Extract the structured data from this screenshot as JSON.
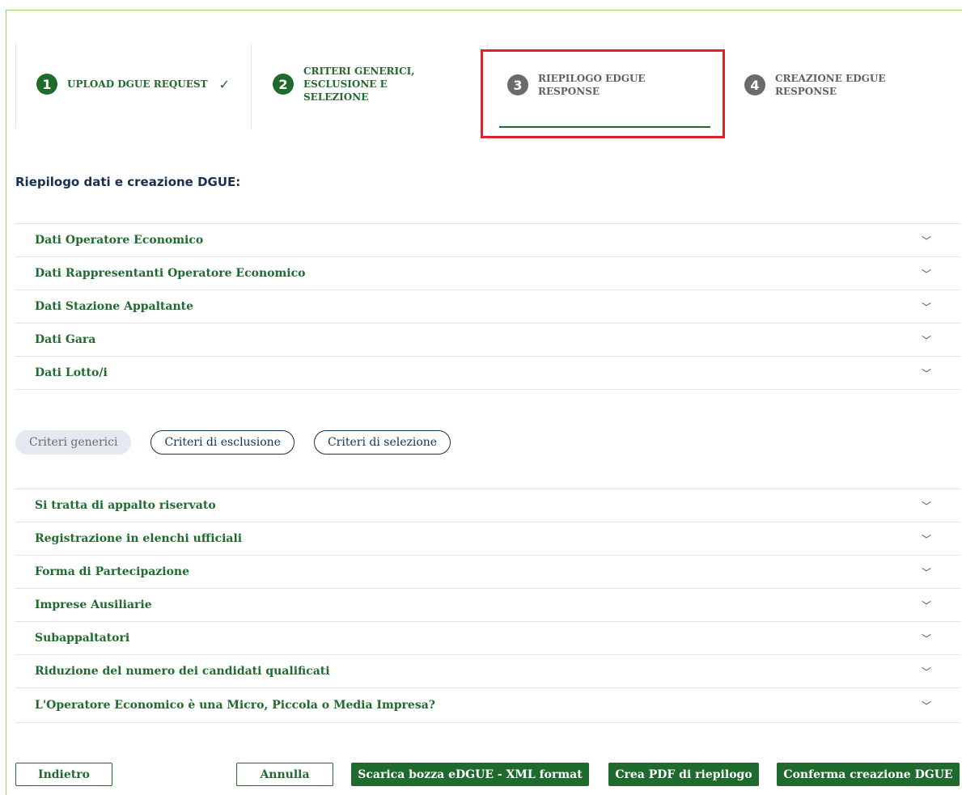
{
  "stepper": {
    "steps": [
      {
        "number": "1",
        "label": "UPLOAD DGUE REQUEST",
        "completed": true
      },
      {
        "number": "2",
        "label": "CRITERI GENERICI,\nESCLUSIONE E\nSELEZIONE",
        "completed": false
      },
      {
        "number": "3",
        "label": "RIEPILOGO EDGUE\nRESPONSE",
        "active": true
      },
      {
        "number": "4",
        "label": "CREAZIONE EDGUE\nRESPONSE"
      }
    ],
    "check_icon": "check-icon"
  },
  "summary": {
    "title": "Riepilogo dati e creazione DGUE:",
    "sections": [
      "Dati Operatore Economico",
      "Dati Rappresentanti Operatore Economico",
      "Dati Stazione Appaltante",
      "Dati Gara",
      "Dati Lotto/i"
    ]
  },
  "criteria_tabs": {
    "items": [
      "Criteri generici",
      "Criteri di esclusione",
      "Criteri di selezione"
    ],
    "selected": "Criteri generici"
  },
  "criteria_sections": [
    "Si tratta di appalto riservato",
    "Registrazione in elenchi ufficiali",
    "Forma di Partecipazione",
    "Imprese Ausiliarie",
    "Subappaltatori",
    "Riduzione del numero dei candidati qualificati",
    "L'Operatore Economico è una Micro, Piccola o Media Impresa?"
  ],
  "buttons": {
    "back": "Indietro",
    "cancel": "Annulla",
    "download_xml": "Scarica bozza eDGUE - XML format",
    "create_pdf": "Crea PDF di riepilogo",
    "confirm": "Conferma creazione DGUE"
  },
  "colors": {
    "primary_green": "#1f6b2e",
    "highlight_red": "#e0202a",
    "title_navy": "#15314f"
  }
}
